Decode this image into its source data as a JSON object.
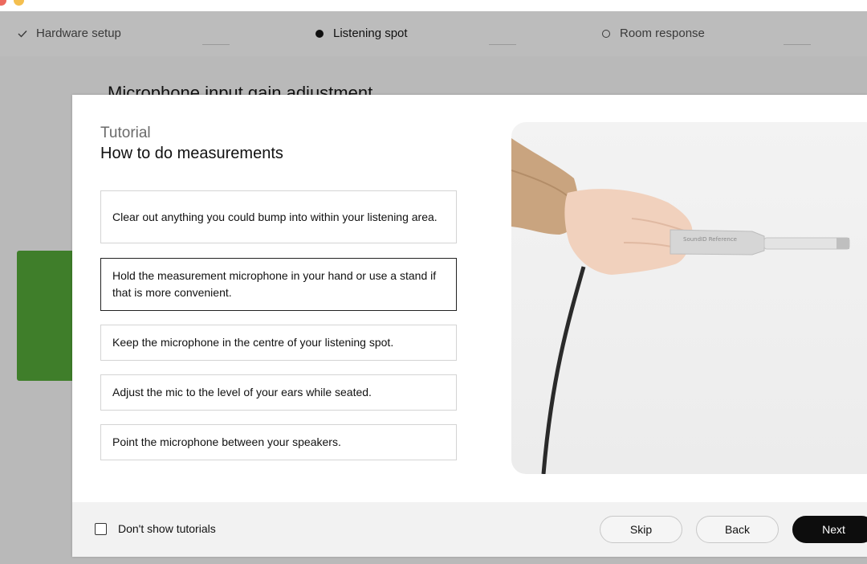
{
  "stepper": {
    "steps": [
      {
        "label": "Hardware setup",
        "state": "done"
      },
      {
        "label": "Listening spot",
        "state": "current"
      },
      {
        "label": "Room response",
        "state": "upcoming"
      }
    ]
  },
  "background": {
    "heading": "Microphone input gain adjustment"
  },
  "modal": {
    "kicker": "Tutorial",
    "title": "How to do measurements",
    "tips": [
      "Clear out anything you could bump into within your listening area.",
      "Hold the measurement microphone in your hand or use a stand if that is more convenient.",
      "Keep the microphone in the centre of your listening spot.",
      "Adjust the mic to the level of your ears while seated.",
      "Point the microphone between your speakers."
    ],
    "active_tip_index": 1,
    "photo": {
      "mic_text": "SoundID Reference"
    },
    "footer": {
      "checkbox_label": "Don't show tutorials",
      "checkbox_checked": false,
      "skip_label": "Skip",
      "back_label": "Back",
      "next_label": "Next"
    }
  },
  "colors": {
    "accent_green": "#3f7e2a",
    "primary_button": "#0d0d0d"
  }
}
